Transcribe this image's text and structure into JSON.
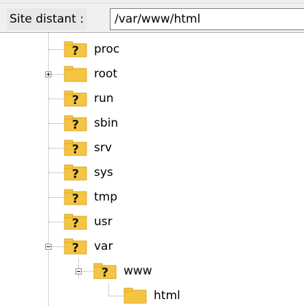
{
  "header": {
    "label": "Site distant :",
    "path": "/var/www/html"
  },
  "tree": {
    "items": [
      {
        "label": "proc",
        "icon": "unknown-folder-icon"
      },
      {
        "label": "root",
        "icon": "folder-icon",
        "expander": "plus"
      },
      {
        "label": "run",
        "icon": "unknown-folder-icon"
      },
      {
        "label": "sbin",
        "icon": "unknown-folder-icon"
      },
      {
        "label": "srv",
        "icon": "unknown-folder-icon"
      },
      {
        "label": "sys",
        "icon": "unknown-folder-icon"
      },
      {
        "label": "tmp",
        "icon": "unknown-folder-icon"
      },
      {
        "label": "usr",
        "icon": "unknown-folder-icon"
      },
      {
        "label": "var",
        "icon": "unknown-folder-icon",
        "expander": "minus"
      },
      {
        "label": "www",
        "icon": "unknown-folder-icon",
        "expander": "minus"
      },
      {
        "label": "html",
        "icon": "folder-icon",
        "selected": true
      }
    ]
  },
  "colors": {
    "folder": "#f5c542",
    "folder_dark": "#d9a520",
    "question": "#1a1a1a"
  }
}
